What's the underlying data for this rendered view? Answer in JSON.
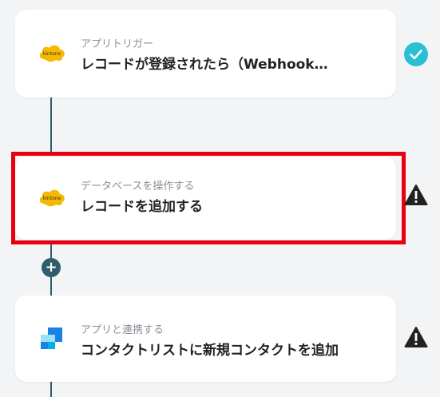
{
  "steps": [
    {
      "category": "アプリトリガー",
      "title": "レコードが登録されたら（Webhook…",
      "app": "kintone",
      "logo_text": "kintone",
      "status": "check-icon"
    },
    {
      "category": "データベースを操作する",
      "title": "レコードを追加する",
      "app": "kintone",
      "logo_text": "kintone",
      "status": "warning-icon"
    },
    {
      "category": "アプリと連携する",
      "title": "コンタクトリストに新規コンタクトを追加",
      "app": "sendgrid",
      "status": "warning-icon"
    }
  ],
  "add_button_label": "+",
  "colors": {
    "connector": "#2f5d6b",
    "highlight": "#e60012",
    "success": "#2bbfd4",
    "warning": "#222222",
    "kintone": "#f6b800",
    "sendgrid_dark": "#1a82e2",
    "sendgrid_light": "#99e1f4"
  }
}
